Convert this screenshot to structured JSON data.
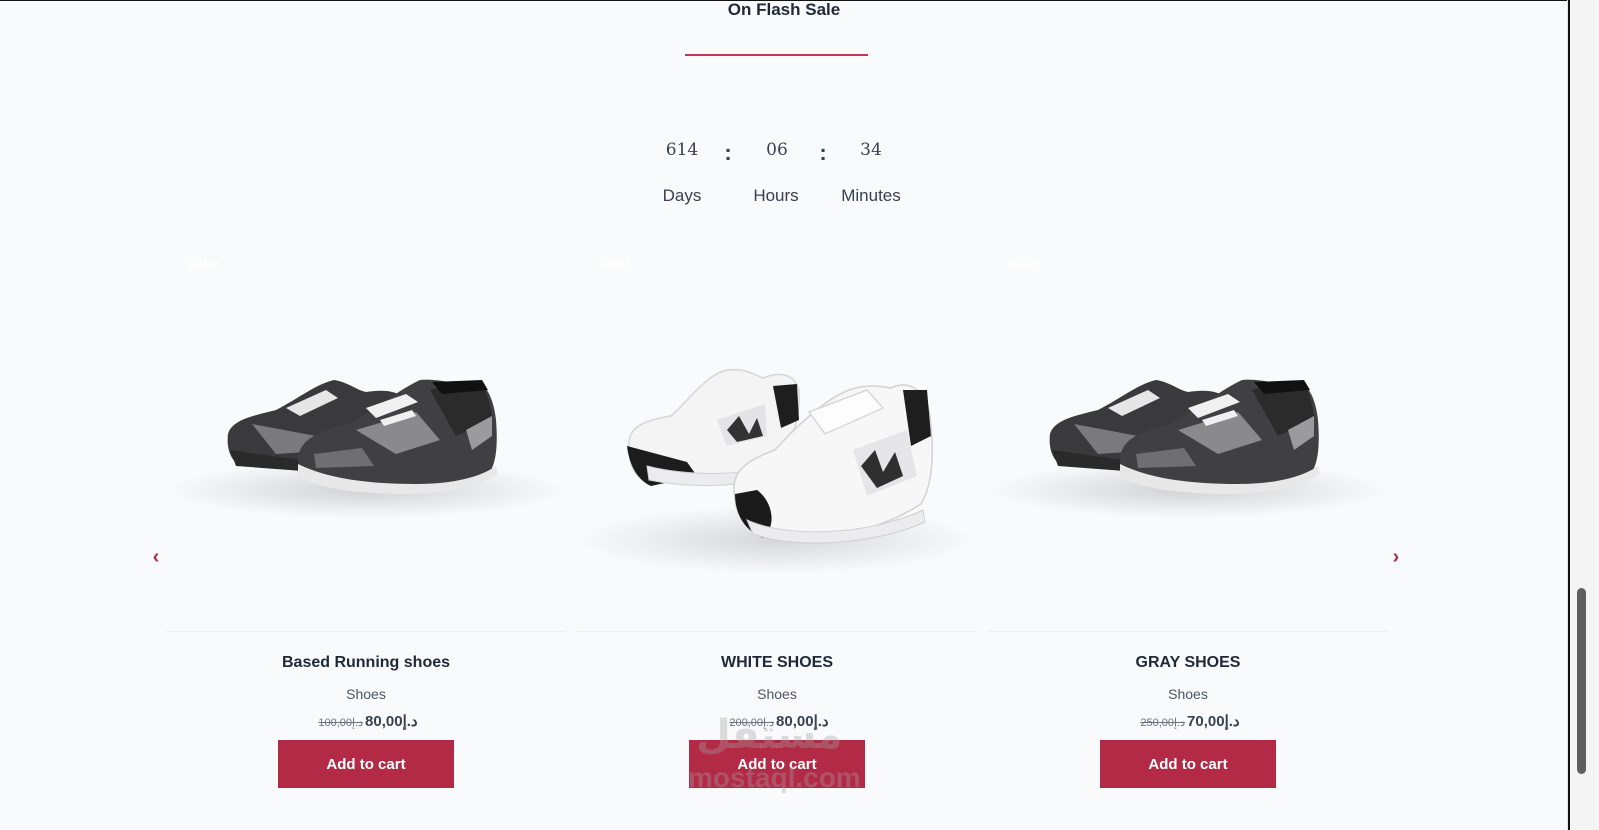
{
  "section": {
    "title": "On Flash Sale"
  },
  "countdown": {
    "days": "614",
    "hours": "06",
    "minutes": "34",
    "separator": ":",
    "days_label": "Days",
    "hours_label": "Hours",
    "minutes_label": "Minutes"
  },
  "products": [
    {
      "badge": "Sale!",
      "name": "Based Running shoes",
      "category": "Shoes",
      "currency": "د.إ",
      "price": "80,00",
      "old_price": "100,00",
      "button": "Add to cart"
    },
    {
      "badge": "Sale!",
      "name": "WHITE SHOES",
      "category": "Shoes",
      "currency": "د.إ",
      "price": "80,00",
      "old_price": "200,00",
      "button": "Add to cart"
    },
    {
      "badge": "Sale!",
      "name": "GRAY SHOES",
      "category": "Shoes",
      "currency": "د.إ",
      "price": "70,00",
      "old_price": "250,00",
      "button": "Add to cart"
    }
  ],
  "watermark": {
    "arabic": "مستقل",
    "latin": "mostaql.com"
  },
  "colors": {
    "accent": "#b22a46",
    "underline": "#c0394f",
    "background": "#f9fafb"
  }
}
